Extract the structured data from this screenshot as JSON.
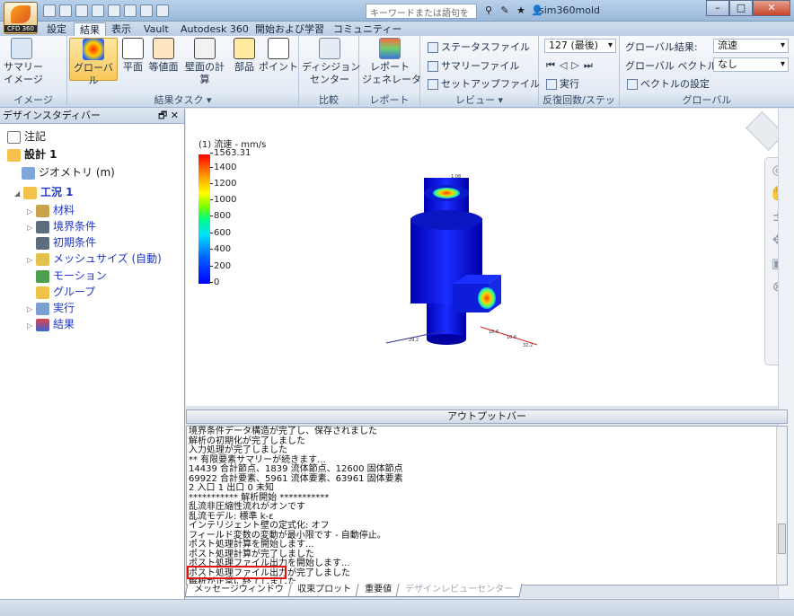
{
  "app": {
    "logo_label": "CFD 360",
    "search_placeholder": "キーワードまたは語句を入力",
    "user": "sim360mold"
  },
  "window_buttons": [
    "–",
    "□",
    "✕"
  ],
  "tabs": [
    "設定",
    "結果",
    "表示",
    "Vault",
    "Autodesk 360",
    "開始および学習",
    "コミュニティー"
  ],
  "active_tab": "結果",
  "ribbon": {
    "image": {
      "title": "イメージ",
      "summary_image": "サマリー\nイメージ"
    },
    "result_tasks": {
      "title": "結果タスク ▾",
      "buttons": [
        "グローバル",
        "平面",
        "等値面",
        "壁面の計算",
        "部品",
        "ポイント"
      ]
    },
    "compare": {
      "title": "比較",
      "decision_center": "ディシジョン\nセンター"
    },
    "report": {
      "title": "レポート",
      "report_generator": "レポート\nジェネレータ"
    },
    "review": {
      "title": "レビュー ▾",
      "items": [
        "ステータスファイル",
        "サマリーファイル",
        "セットアップファイル"
      ]
    },
    "iterations": {
      "title": "反復回数/ステップ",
      "combo_value": "127 (最後)",
      "run_label": "実行",
      "transport_icons": [
        "⏮",
        "◁",
        "▷",
        "⏭"
      ]
    },
    "global": {
      "title": "グローバル",
      "result_label": "グローバル結果:",
      "result_value": "流速",
      "vector_label": "グローバル ベクトル:",
      "vector_value": "なし",
      "vector_settings": "ベクトルの設定"
    }
  },
  "study_panel": {
    "title": "デザインスタディバー",
    "pin_close": "🗗 ✕",
    "tree": [
      {
        "label": "注記"
      },
      {
        "label": "設計 1"
      },
      {
        "label": "ジオメトリ (m)"
      },
      {
        "label": "工況 1"
      },
      {
        "label": "材料"
      },
      {
        "label": "境界条件"
      },
      {
        "label": "初期条件"
      },
      {
        "label": "メッシュサイズ (自動)"
      },
      {
        "label": "モーション"
      },
      {
        "label": "グループ"
      },
      {
        "label": "実行"
      },
      {
        "label": "結果"
      }
    ]
  },
  "legend": {
    "title": "(1) 流速 - mm/s",
    "max": "1563.31",
    "ticks": [
      "1400",
      "1200",
      "1000",
      "800",
      "600",
      "400",
      "200",
      "0"
    ],
    "colors": [
      "#ff0000",
      "#ffa500",
      "#ffff00",
      "#00ff80",
      "#00e0ff",
      "#0000ff"
    ]
  },
  "model": {
    "axis_labels": [
      "1.08",
      "29.2",
      "18.6",
      "10.6",
      "32.2"
    ]
  },
  "output": {
    "header": "アウトプットバー",
    "lines": [
      "境界条件データ構造が完了し、保存されました",
      "解析の初期化が完了しました",
      "入力処理が完了しました",
      "** 有限要素サマリーが続きます...",
      "14439 合計節点、1839 流体節点、12600 固体節点",
      "69922 合計要素、5961 流体要素、63961 固体要素",
      "2 入口  1 出口  0 未知",
      "*********** 解析開始 ***********",
      "乱流非圧縮性流れがオンです",
      "乱流モデル: 標準 k-ε",
      "インテリジェント壁の定式化: オフ",
      "フィールド変数の変動が最小限です - 自動停止。",
      "ポスト処理計算を開始します...",
      "ポスト処理計算が完了しました",
      "ポスト処理ファイル出力を開始します...",
      "ポスト処理ファイル出力が完了しました",
      "解析が正常に終了しました"
    ],
    "tabs": [
      "メッセージウィンドウ",
      "収束プロット",
      "重要値",
      "デザインレビューセンター"
    ]
  },
  "nav_icons": [
    "steering-wheel",
    "pan",
    "zoom",
    "orbit",
    "look",
    "walk"
  ]
}
